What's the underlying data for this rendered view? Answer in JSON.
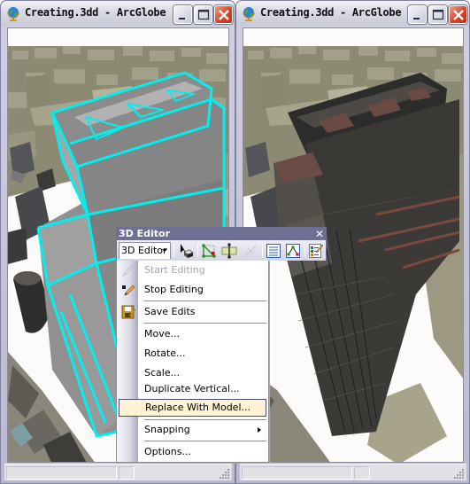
{
  "windows": [
    {
      "title": "Creating.3dd - ArcGlobe",
      "view": "wireframe-selection",
      "selection_color": "#00f0f0"
    },
    {
      "title": "Creating.3dd - ArcGlobe",
      "view": "textured-model"
    }
  ],
  "caption_buttons": [
    "minimize",
    "maximize",
    "close"
  ],
  "toolbar": {
    "title": "3D Editor",
    "close_glyph": "✕",
    "dropdown_label": "3D Editor",
    "tools": [
      {
        "name": "edit-placement-tool",
        "enabled": true
      },
      {
        "name": "edit-vertices-tool",
        "enabled": true
      },
      {
        "name": "split-tool",
        "enabled": true
      },
      {
        "name": "cut-polygon-tool",
        "enabled": false
      },
      {
        "name": "attributes-tool",
        "enabled": true
      },
      {
        "name": "sketch-properties-tool",
        "enabled": true
      },
      {
        "name": "editor-options-tool",
        "enabled": true
      }
    ]
  },
  "menu": {
    "items": [
      {
        "label": "Start Editing",
        "enabled": false,
        "icon": "pencil-disabled"
      },
      {
        "label": "Stop Editing",
        "enabled": true,
        "icon": "pencil-stop"
      },
      {
        "label": "Save Edits",
        "enabled": true,
        "icon": "save-disk"
      },
      {
        "label": "Move...",
        "enabled": true
      },
      {
        "label": "Rotate...",
        "enabled": true
      },
      {
        "label": "Scale...",
        "enabled": true
      },
      {
        "label": "Duplicate Vertical...",
        "enabled": true
      },
      {
        "label": "Replace With Model...",
        "enabled": true,
        "highlighted": true
      },
      {
        "label": "Snapping",
        "enabled": true,
        "submenu": true
      },
      {
        "label": "Options...",
        "enabled": true
      }
    ],
    "highlight_color": "#fff3d3"
  }
}
